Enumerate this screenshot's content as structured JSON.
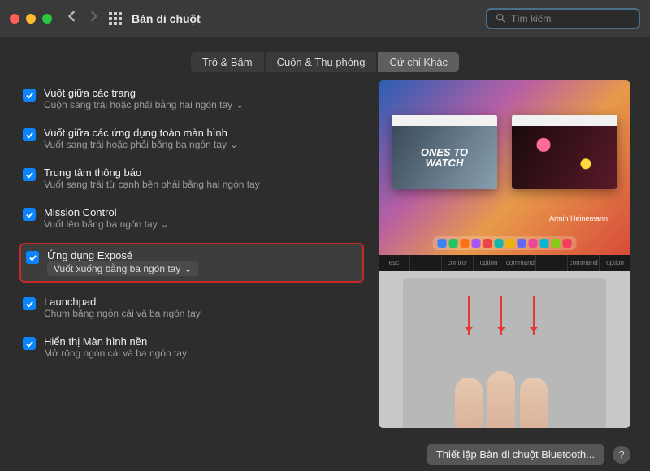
{
  "titlebar": {
    "title": "Bàn di chuột",
    "search_placeholder": "Tìm kiếm"
  },
  "tabs": [
    {
      "label": "Trỏ & Bấm",
      "active": false
    },
    {
      "label": "Cuộn & Thu phóng",
      "active": false
    },
    {
      "label": "Cử chỉ Khác",
      "active": true
    }
  ],
  "settings": [
    {
      "title": "Vuốt giữa các trang",
      "sub": "Cuộn sang trái hoặc phải bằng hai ngón tay",
      "checked": true,
      "dropdown": true,
      "highlight": false
    },
    {
      "title": "Vuốt giữa các ứng dụng toàn màn hình",
      "sub": "Vuốt sang trái hoặc phải bằng ba ngón tay",
      "checked": true,
      "dropdown": true,
      "highlight": false
    },
    {
      "title": "Trung tâm thông báo",
      "sub": "Vuốt sang trái từ cạnh bên phải bằng hai ngón tay",
      "checked": true,
      "dropdown": false,
      "highlight": false
    },
    {
      "title": "Mission Control",
      "sub": "Vuốt lên bằng ba ngón tay",
      "checked": true,
      "dropdown": true,
      "highlight": false
    },
    {
      "title": "Ứng dụng Exposé",
      "sub": "Vuốt xuống bằng ba ngón tay",
      "checked": true,
      "dropdown": true,
      "highlight": true
    },
    {
      "title": "Launchpad",
      "sub": "Chụm bằng ngón cái và ba ngón tay",
      "checked": true,
      "dropdown": false,
      "highlight": false
    },
    {
      "title": "Hiển thị Màn hình nền",
      "sub": "Mở rộng ngón cái và ba ngón tay",
      "checked": true,
      "dropdown": false,
      "highlight": false
    }
  ],
  "preview": {
    "window_left_text": "ONES TO\nWATCH",
    "window_right_label": "Armin Heinemann",
    "keys": [
      "esc",
      "",
      "control",
      "option",
      "command",
      "",
      "command",
      "option"
    ]
  },
  "footer": {
    "bluetooth_button": "Thiết lập Bàn di chuột Bluetooth...",
    "help": "?"
  },
  "colors": {
    "accent": "#0a84ff",
    "highlight_border": "#c62828"
  }
}
